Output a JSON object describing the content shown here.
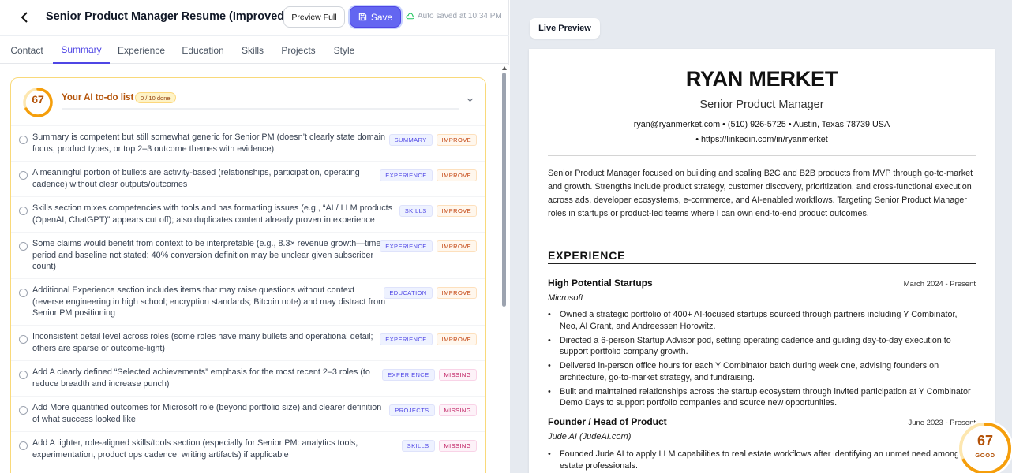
{
  "header": {
    "back_icon": "chevron-left-icon",
    "title": "Senior Product Manager Resume (Improved)",
    "preview_label": "Preview Full",
    "save_label": "Save",
    "autosave_text": "Auto saved at 10:34 PM",
    "accent_color": "#6366f1"
  },
  "tabs": [
    {
      "label": "Contact",
      "active": false
    },
    {
      "label": "Summary",
      "active": true
    },
    {
      "label": "Experience",
      "active": false
    },
    {
      "label": "Education",
      "active": false
    },
    {
      "label": "Skills",
      "active": false
    },
    {
      "label": "Projects",
      "active": false
    },
    {
      "label": "Style",
      "active": false
    }
  ],
  "todo": {
    "score": "67",
    "score_fraction": 0.67,
    "title": "Your AI to-do list",
    "count": "0 / 10 done",
    "progress_fraction": 0.0,
    "items": [
      {
        "text": "Summary is competent but still somewhat generic for Senior PM (doesn’t clearly state domain focus, product types, or top 2–3 outcome themes with evidence)",
        "category": "SUMMARY",
        "status": "IMPROVE"
      },
      {
        "text": "A meaningful portion of bullets are activity-based (relationships, participation, operating cadence) without clear outputs/outcomes",
        "category": "EXPERIENCE",
        "status": "IMPROVE"
      },
      {
        "text": "Skills section mixes competencies with tools and has formatting issues (e.g., “AI / LLM products (OpenAI, ChatGPT)” appears cut off); also duplicates content already proven in experience",
        "category": "SKILLS",
        "status": "IMPROVE"
      },
      {
        "text": "Some claims would benefit from context to be interpretable (e.g., 8.3× revenue growth—time period and baseline not stated; 40% conversion definition may be unclear given subscriber count)",
        "category": "EXPERIENCE",
        "status": "IMPROVE"
      },
      {
        "text": "Additional Experience section includes items that may raise questions without context (reverse engineering in high school; encryption standards; Bitcoin note) and may distract from Senior PM positioning",
        "category": "EDUCATION",
        "status": "IMPROVE"
      },
      {
        "text": "Inconsistent detail level across roles (some roles have many bullets and operational detail; others are sparse or outcome-light)",
        "category": "EXPERIENCE",
        "status": "IMPROVE"
      },
      {
        "text": "Add A clearly defined “Selected achievements” emphasis for the most recent 2–3 roles (to reduce breadth and increase punch)",
        "category": "EXPERIENCE",
        "status": "MISSING"
      },
      {
        "text": "Add More quantified outcomes for Microsoft role (beyond portfolio size) and clearer definition of what success looked like",
        "category": "PROJECTS",
        "status": "MISSING"
      },
      {
        "text": "Add A tighter, role-aligned skills/tools section (especially for Senior PM: analytics tools, experimentation, product ops cadence, writing artifacts) if applicable",
        "category": "SKILLS",
        "status": "MISSING"
      }
    ]
  },
  "preview": {
    "label": "Live Preview",
    "name": "RYAN MERKET",
    "role": "Senior Product Manager",
    "contact_line1": "ryan@ryanmerket.com    •  (510) 926-5725    •  Austin, Texas 78739 USA",
    "contact_line2": "•  https://linkedin.com/in/ryanmerket",
    "summary": "Senior Product Manager focused on building and scaling B2C and B2B products from MVP through go-to-market and growth. Strengths include product strategy, customer discovery, prioritization, and cross-functional execution across ads, developer ecosystems, e-commerce, and AI-enabled workflows. Targeting Senior Product Manager roles in startups or product-led teams where I can own end-to-end product outcomes.",
    "experience_heading": "EXPERIENCE",
    "jobs": [
      {
        "company": "High Potential Startups",
        "employer": "Microsoft",
        "dates": "March 2024 - Present",
        "bullets": [
          "Owned a strategic portfolio of 400+ AI-focused startups sourced through partners including Y Combinator, Neo, AI Grant, and Andreessen Horowitz.",
          "Directed a 6-person Startup Advisor pod, setting operating cadence and guiding day-to-day execution to support portfolio company growth.",
          "Delivered in-person office hours for each Y Combinator batch during week one, advising founders on architecture, go-to-market strategy, and fundraising.",
          "Built and maintained relationships across the startup ecosystem through invited participation at Y Combinator Demo Days to support portfolio companies and source new opportunities."
        ]
      },
      {
        "company": "Founder / Head of Product",
        "employer": "Jude AI (JudeAI.com)",
        "dates": "June 2023 - Present",
        "bullets": [
          "Founded Jude AI to apply LLM capabilities to real estate workflows after identifying an unmet need among real estate professionals."
        ]
      }
    ]
  },
  "score_badge": {
    "score": "67",
    "label": "GOOD",
    "fraction": 0.67,
    "color": "#f59e0b"
  }
}
